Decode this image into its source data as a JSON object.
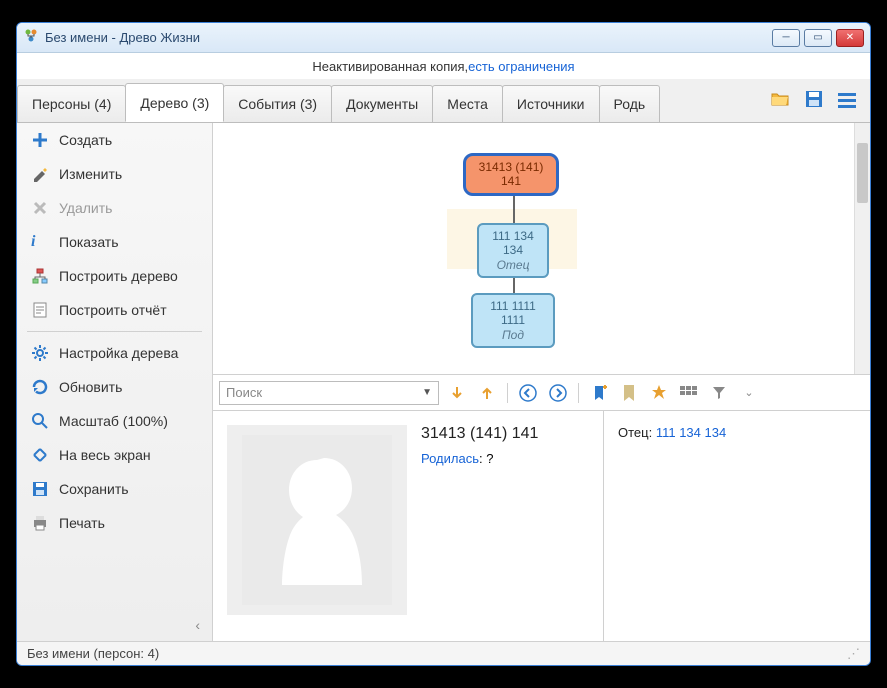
{
  "window": {
    "title": "Без имени - Древо Жизни"
  },
  "activation": {
    "text": "Неактивированная копия, ",
    "link": "есть ограничения"
  },
  "tabs": [
    {
      "label": "Персоны (4)"
    },
    {
      "label": "Дерево (3)",
      "active": true
    },
    {
      "label": "События (3)"
    },
    {
      "label": "Документы"
    },
    {
      "label": "Места"
    },
    {
      "label": "Источники"
    },
    {
      "label": "Родь"
    }
  ],
  "sidebar": {
    "create": "Создать",
    "edit": "Изменить",
    "delete": "Удалить",
    "show": "Показать",
    "buildtree": "Построить дерево",
    "buildreport": "Построить отчёт",
    "settings": "Настройка дерева",
    "refresh": "Обновить",
    "zoom": "Масштаб (100%)",
    "fullscreen": "На весь экран",
    "save": "Сохранить",
    "print": "Печать"
  },
  "tree": {
    "root": "31413 (141) 141",
    "father": "111 134 134",
    "father_role": "Отец",
    "g": "111 1111 1111",
    "g_role": "Под"
  },
  "search": {
    "placeholder": "Поиск"
  },
  "person": {
    "name": "31413 (141) 141",
    "born_label": "Родилась",
    "born_value": ": ?",
    "father_label": "Отец: ",
    "father_link": "111 134 134"
  },
  "status": "Без имени (персон: 4)"
}
